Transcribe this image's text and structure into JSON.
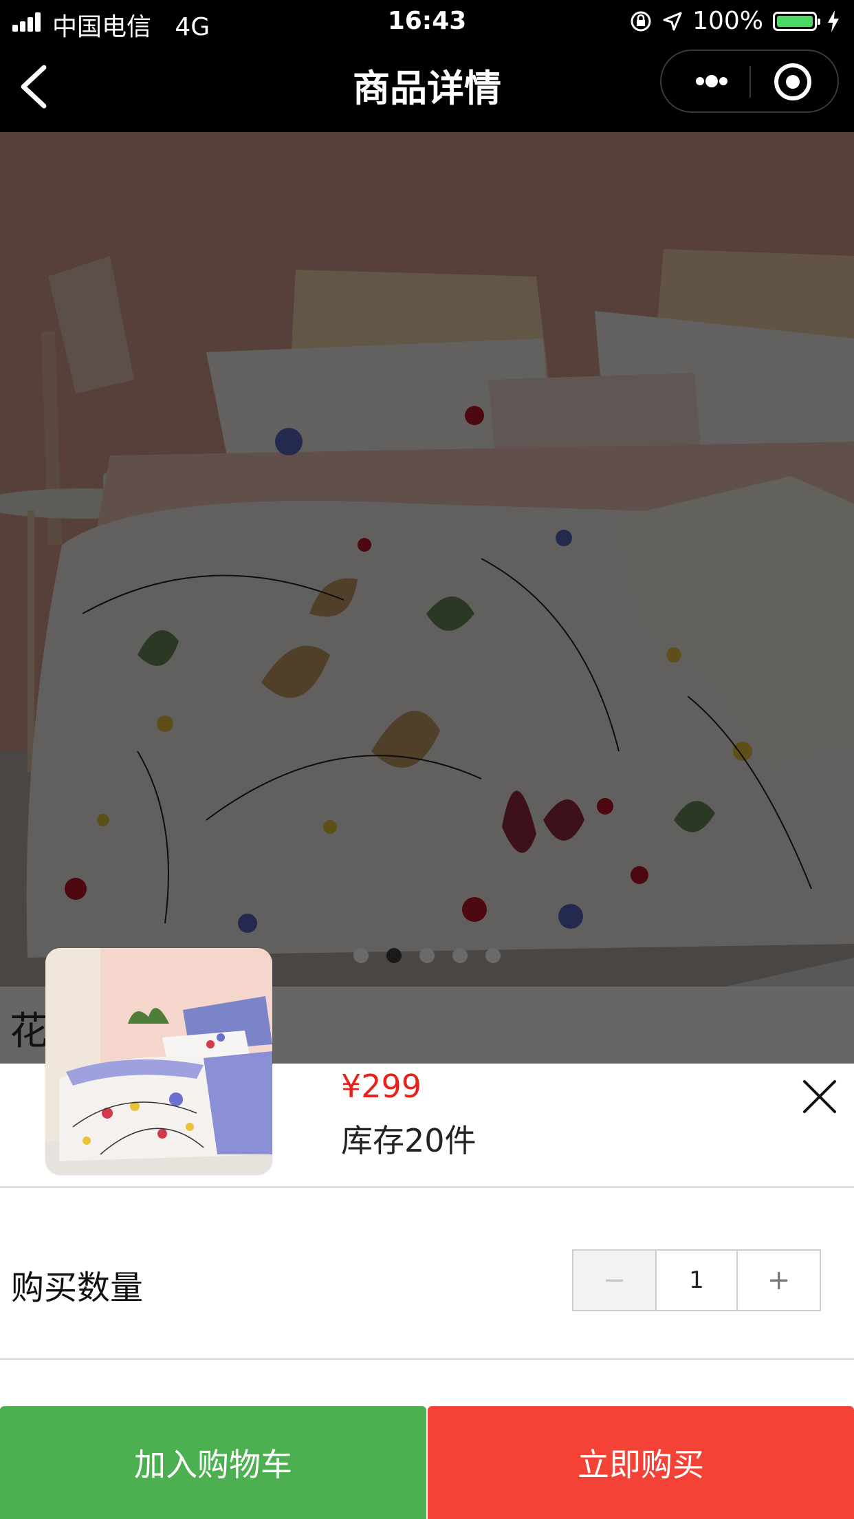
{
  "status_bar": {
    "carrier": "中国电信",
    "network": "4G",
    "time": "16:43",
    "battery": "100%"
  },
  "nav": {
    "title": "商品详情",
    "back_icon": "chevron-left-icon",
    "more_icon": "more-dots-icon",
    "close_icon": "target-circle-icon"
  },
  "product": {
    "title_partial": "花                      套",
    "carousel": {
      "count": 5,
      "active_index": 1
    }
  },
  "sku_sheet": {
    "price": "¥299",
    "stock": "库存20件",
    "quantity_label": "购买数量",
    "quantity": "1",
    "minus": "−",
    "plus": "+"
  },
  "actions": {
    "add_to_cart": "加入购物车",
    "buy_now": "立即购买"
  },
  "colors": {
    "price": "#e8221a",
    "cart_button": "#4caf50",
    "buy_button": "#f44336"
  }
}
